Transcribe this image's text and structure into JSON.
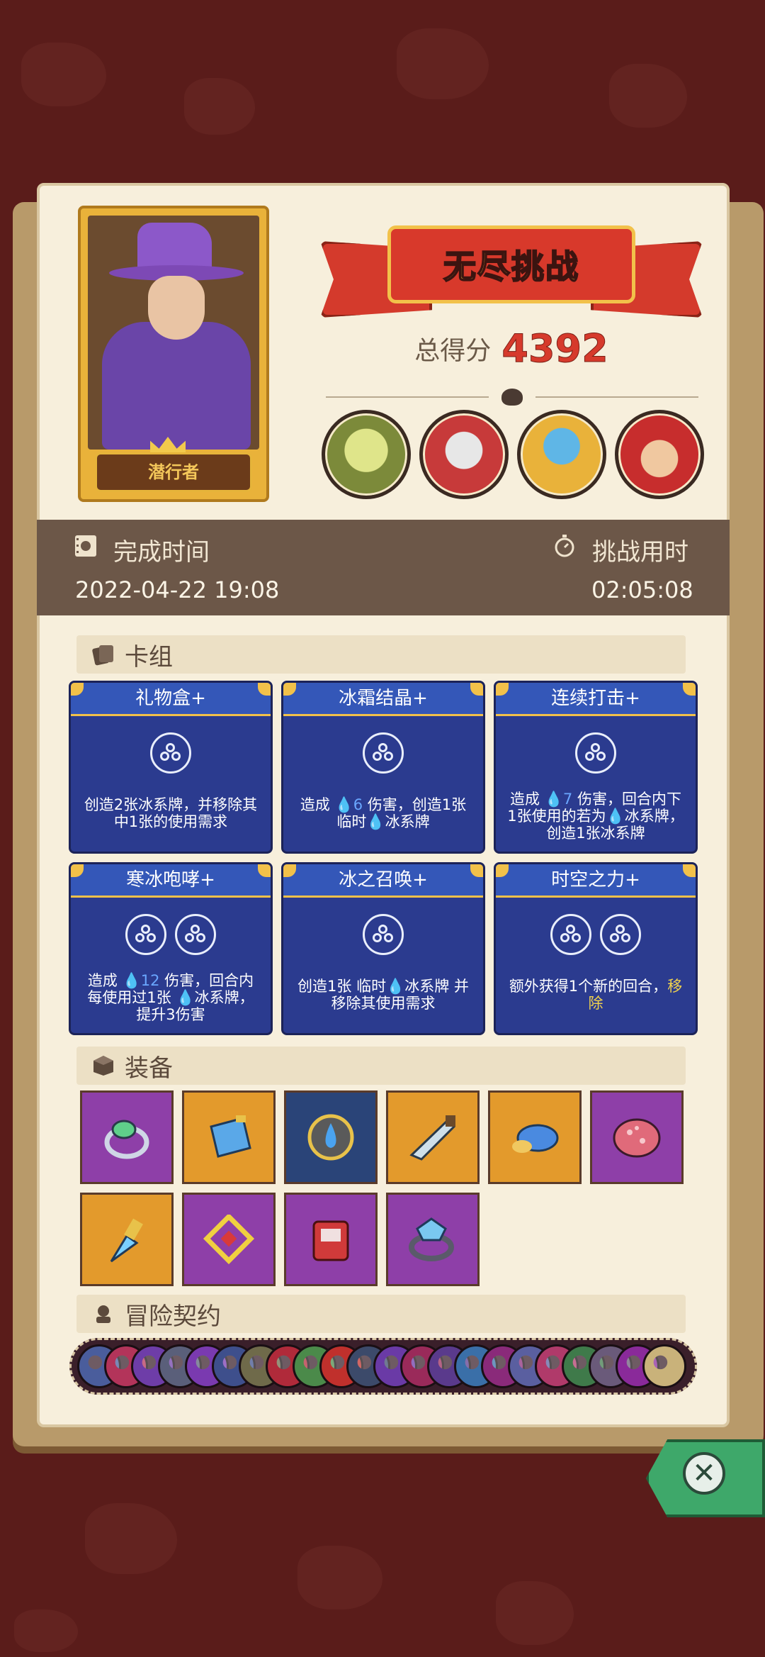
{
  "hero": {
    "name": "潜行者"
  },
  "banner": {
    "title": "无尽挑战"
  },
  "score": {
    "label": "总得分",
    "value": "4392"
  },
  "bosses": [
    {
      "icon": "skull-beast-icon",
      "color": "#c9d46a"
    },
    {
      "icon": "caged-monster-icon",
      "color": "#c73a3a"
    },
    {
      "icon": "blue-mask-icon",
      "color": "#e9b23a"
    },
    {
      "icon": "red-hat-demon-icon",
      "color": "#d9552f"
    }
  ],
  "time": {
    "finish_label": "完成时间",
    "finish_value": "2022-04-22 19:08",
    "duration_label": "挑战用时",
    "duration_value": "02:05:08"
  },
  "deck": {
    "label": "卡组",
    "cards": [
      {
        "title": "礼物盒+",
        "cost": 1,
        "desc": [
          "创造2张冰系牌，并移除其",
          "中1张的使用需求"
        ]
      },
      {
        "title": "冰霜结晶+",
        "cost": 1,
        "desc_parts": {
          "pre": "造成 ",
          "dmg": "6",
          "post": " 伤害，创造1张",
          "line2a": "临时",
          "line2b": "冰系牌"
        }
      },
      {
        "title": "连续打击+",
        "cost": 1,
        "desc_parts": {
          "pre": "造成 ",
          "dmg": "7",
          "post": " 伤害，回合内下",
          "line2a": "1张使用的若为",
          "line2b": "冰系牌，",
          "line3": "创造1张冰系牌"
        }
      },
      {
        "title": "寒冰咆哮+",
        "cost": 2,
        "desc_parts": {
          "pre": "造成 ",
          "dmg": "12",
          "post": " 伤害，回合内",
          "line2a": "每使用过1张 ",
          "line2b": "冰系牌，",
          "line3": "提升3伤害"
        }
      },
      {
        "title": "冰之召唤+",
        "cost": 1,
        "desc_parts": {
          "line1a": "创造1张 临时",
          "line1b": "冰系牌 并",
          "line2": "移除其使用需求"
        }
      },
      {
        "title": "时空之力+",
        "cost": 2,
        "desc_parts": {
          "line1a": "额外获得1个新的回合，",
          "line1b": "移",
          "line2": "除"
        }
      }
    ]
  },
  "equipment": {
    "label": "装备",
    "items": [
      {
        "icon": "leaf-ring-icon",
        "bg": "#8e3fa8"
      },
      {
        "icon": "blue-crystal-icon",
        "bg": "#e39a2c"
      },
      {
        "icon": "water-amulet-icon",
        "bg": "#2a4478"
      },
      {
        "icon": "ice-blade-icon",
        "bg": "#e39a2c"
      },
      {
        "icon": "blue-mushroom-icon",
        "bg": "#e39a2c"
      },
      {
        "icon": "spotted-shell-icon",
        "bg": "#8e3fa8"
      },
      {
        "icon": "ice-dagger-icon",
        "bg": "#e39a2c"
      },
      {
        "icon": "gold-rune-icon",
        "bg": "#8e3fa8"
      },
      {
        "icon": "bloody-tome-icon",
        "bg": "#8e3fa8"
      },
      {
        "icon": "diamond-ring-icon",
        "bg": "#8e3fa8"
      }
    ]
  },
  "contracts": {
    "label": "冒险契约",
    "colors": [
      "#4a5d9c",
      "#b3345a",
      "#6e3da8",
      "#5a5f7a",
      "#7a3ab0",
      "#3e4f8c",
      "#6f6a4a",
      "#b02a3a",
      "#4b8a4a",
      "#c0302c",
      "#3c4a6a",
      "#6a3aa6",
      "#9a2a5a",
      "#5a3a8c",
      "#3a6fa8",
      "#8a2a7a",
      "#5a5fa0",
      "#b03a6a",
      "#3f7a4a",
      "#6a5a7a",
      "#8a2a9a",
      "#c9b27a"
    ]
  },
  "colors": {
    "page": "#f7efdc",
    "time_bar": "#6c5748",
    "card_bg": "#2b3b8f",
    "score_red": "#d63a2c"
  }
}
